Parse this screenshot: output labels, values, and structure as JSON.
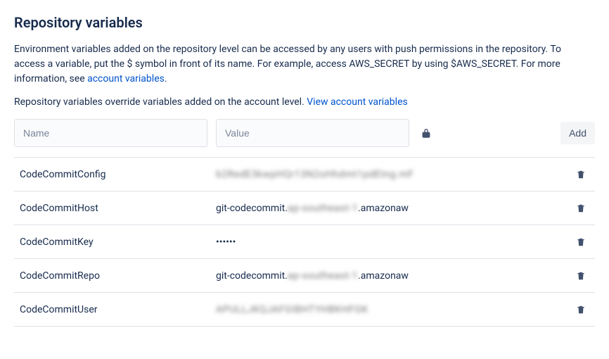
{
  "title": "Repository variables",
  "intro_text": "Environment variables added on the repository level can be accessed by any users with push permissions in the repository. To access a variable, put the $ symbol in front of its name. For example, access AWS_SECRET by using $AWS_SECRET. For more information, see ",
  "intro_link": "account variables",
  "intro_after": ".",
  "override_text": "Repository variables override variables added on the account level. ",
  "override_link": "View account variables",
  "form": {
    "name_placeholder": "Name",
    "value_placeholder": "Value",
    "add_label": "Add"
  },
  "variables": [
    {
      "name": "CodeCommitConfig",
      "value_prefix": "",
      "value_blur": "b2RedE3kwpHQr13N2oHhdmt1pdEtng.mF",
      "value_suffix": ""
    },
    {
      "name": "CodeCommitHost",
      "value_prefix": "git-codecommit.",
      "value_blur": "ap-southeast-1",
      "value_suffix": ".amazonaw"
    },
    {
      "name": "CodeCommitKey",
      "value_prefix": "••••••",
      "value_blur": "",
      "value_suffix": ""
    },
    {
      "name": "CodeCommitRepo",
      "value_prefix": "git-codecommit.",
      "value_blur": "ap-southeast-1",
      "value_suffix": ".amazonaw"
    },
    {
      "name": "CodeCommitUser",
      "value_prefix": "",
      "value_blur": "APULLJKQJAFGIBHTYHBKHFGK",
      "value_suffix": ""
    }
  ]
}
